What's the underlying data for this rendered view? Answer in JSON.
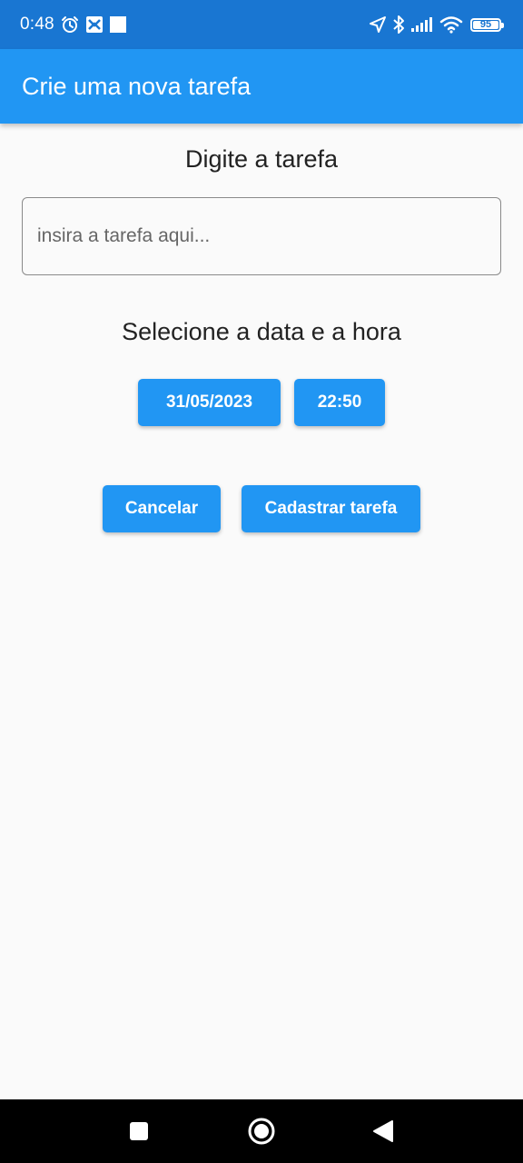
{
  "status_bar": {
    "time": "0:48",
    "battery": "95",
    "battery_level": 0.95,
    "icons": [
      "alarm-icon",
      "app-notification-icon",
      "square-notification-icon",
      "location-arrow-icon",
      "bluetooth-icon",
      "signal-icon",
      "wifi-icon",
      "battery-icon"
    ]
  },
  "app_bar": {
    "title": "Crie uma nova tarefa"
  },
  "form": {
    "task_heading": "Digite a tarefa",
    "task_input": {
      "value": "",
      "placeholder": "insira a tarefa aqui..."
    },
    "datetime_heading": "Selecione a data e a hora",
    "date_button": "31/05/2023",
    "time_button": "22:50",
    "cancel_button": "Cancelar",
    "submit_button": "Cadastrar tarefa"
  },
  "nav_bar": {
    "icons": [
      "recents-square-icon",
      "home-circle-icon",
      "back-triangle-icon"
    ]
  },
  "colors": {
    "status_bar": "#1976d2",
    "app_bar": "#2196f3",
    "button": "#2196f3",
    "background": "#fafafa",
    "nav_bar": "#000000"
  }
}
